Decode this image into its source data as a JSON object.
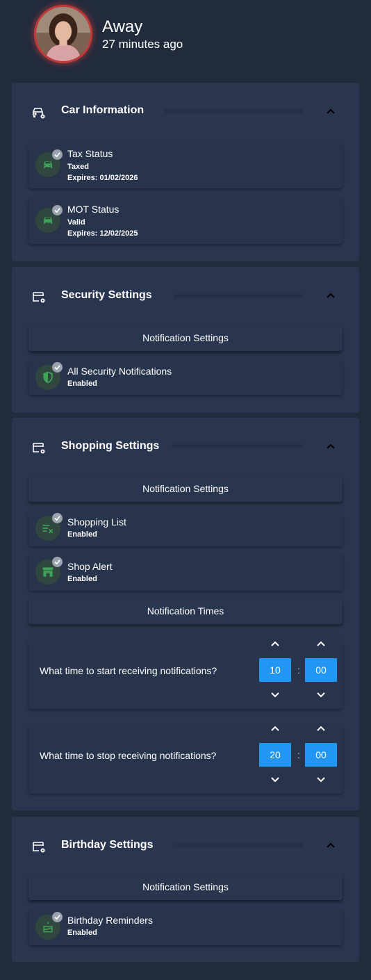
{
  "profile": {
    "status": "Away",
    "last_seen": "27 minutes ago"
  },
  "colors": {
    "background": "#222b3c",
    "card": "#2a3650",
    "accent_blue": "#2196f3",
    "icon_green": "#3fa35a",
    "avatar_ring": "#c03a3a"
  },
  "car": {
    "title": "Car Information",
    "items": [
      {
        "title": "Tax Status",
        "line1": "Taxed",
        "line2": "Expires: 01/02/2026",
        "icon": "car-icon"
      },
      {
        "title": "MOT Status",
        "line1": "Valid",
        "line2": "Expires: 12/02/2025",
        "icon": "car-icon"
      }
    ]
  },
  "security": {
    "title": "Security Settings",
    "button": "Notification Settings",
    "items": [
      {
        "title": "All Security Notifications",
        "status": "Enabled",
        "icon": "shield-icon"
      }
    ]
  },
  "shopping": {
    "title": "Shopping Settings",
    "button": "Notification Settings",
    "items": [
      {
        "title": "Shopping List",
        "status": "Enabled",
        "icon": "list-remove-icon"
      },
      {
        "title": "Shop Alert",
        "status": "Enabled",
        "icon": "storefront-icon"
      }
    ],
    "times_button": "Notification Times",
    "start": {
      "label": "What time to start receiving notifications?",
      "hour": "10",
      "minute": "00"
    },
    "stop": {
      "label": "What time to stop receiving notifications?",
      "hour": "20",
      "minute": "00"
    },
    "separator": ":"
  },
  "birthday": {
    "title": "Birthday Settings",
    "button": "Notification Settings",
    "items": [
      {
        "title": "Birthday Reminders",
        "status": "Enabled",
        "icon": "cake-icon"
      }
    ]
  }
}
